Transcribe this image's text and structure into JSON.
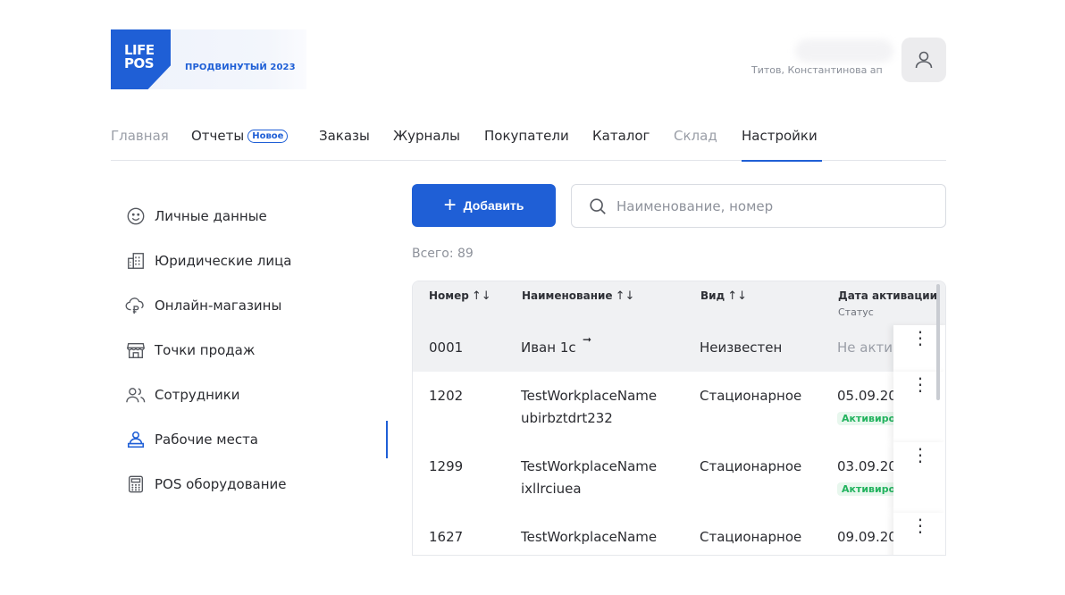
{
  "brand": {
    "logo_line1": "LIFE",
    "logo_line2": "POS",
    "plan": "ПРОДВИНУТЫЙ 2023"
  },
  "user": {
    "name": "Титов, Константинова ап"
  },
  "nav": {
    "items": [
      {
        "label": "Главная"
      },
      {
        "label": "Отчеты",
        "badge": "Новое"
      },
      {
        "label": "Заказы"
      },
      {
        "label": "Журналы"
      },
      {
        "label": "Покупатели"
      },
      {
        "label": "Каталог"
      },
      {
        "label": "Склад"
      },
      {
        "label": "Настройки"
      }
    ]
  },
  "sidebar": {
    "items": [
      {
        "label": "Личные данные",
        "icon": "smile-icon"
      },
      {
        "label": "Юридические лица",
        "icon": "building-icon"
      },
      {
        "label": "Онлайн-магазины",
        "icon": "cloud-ruble-icon"
      },
      {
        "label": "Точки продаж",
        "icon": "store-icon"
      },
      {
        "label": "Сотрудники",
        "icon": "users-icon"
      },
      {
        "label": "Рабочие места",
        "icon": "workplace-icon"
      },
      {
        "label": "POS оборудование",
        "icon": "calculator-icon"
      }
    ]
  },
  "toolbar": {
    "add_label": "Добавить",
    "search_placeholder": "Наименование, номер"
  },
  "total": "Всего: 89",
  "table": {
    "headers": {
      "number": "Номер",
      "name": "Наименование",
      "type": "Вид",
      "date": "Дата активации",
      "status": "Статус"
    },
    "rows": [
      {
        "number": "0001",
        "name1": "Иван 1с",
        "name2": "",
        "type": "Неизвестен",
        "date": "Не акти",
        "status": ""
      },
      {
        "number": "1202",
        "name1": "TestWorkplaceName",
        "name2": "ubirbztdrt232",
        "type": "Стационарное",
        "date": "05.09.20",
        "status": "Активиро"
      },
      {
        "number": "1299",
        "name1": "TestWorkplaceName",
        "name2": "ixllrciuea",
        "type": "Стационарное",
        "date": "03.09.20",
        "status": "Активиро"
      },
      {
        "number": "1627",
        "name1": "TestWorkplaceName",
        "name2": "",
        "type": "Стационарное",
        "date": "09.09.20",
        "status": ""
      }
    ]
  },
  "colors": {
    "accent": "#1f5fd6",
    "status_green": "#22b35e"
  }
}
